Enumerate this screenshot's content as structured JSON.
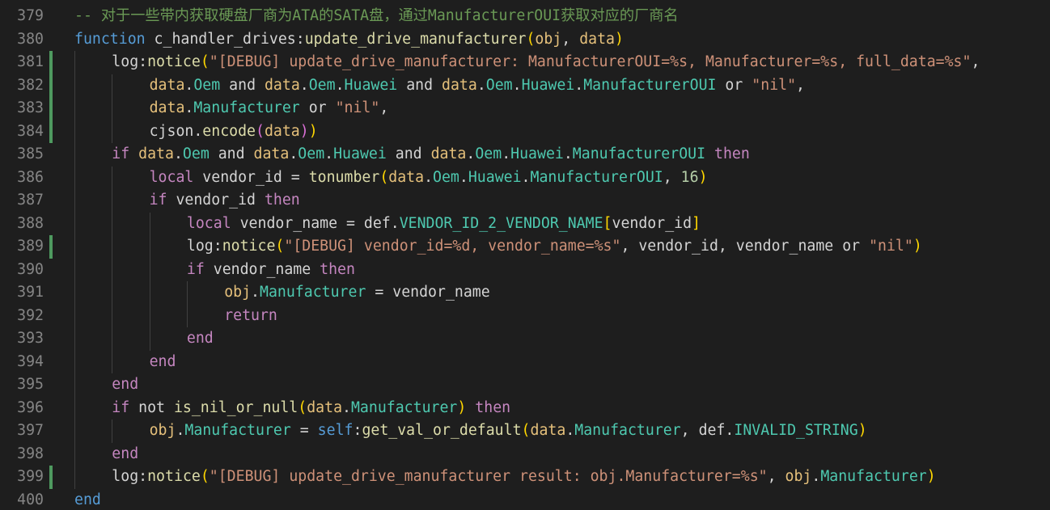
{
  "editor": {
    "lines": [
      {
        "num": "379",
        "indent": 0,
        "mod": false,
        "tokens": [
          [
            "cm",
            "-- 对于一些带内获取硬盘厂商为ATA的SATA盘，通过ManufacturerOUI获取对应的厂商名"
          ]
        ]
      },
      {
        "num": "380",
        "indent": 0,
        "mod": false,
        "tokens": [
          [
            "kw2",
            "function"
          ],
          [
            "var",
            " c_handler_drives:"
          ],
          [
            "fn",
            "update_drive_manufacturer"
          ],
          [
            "br1",
            "("
          ],
          [
            "obj",
            "obj"
          ],
          [
            "var",
            ", "
          ],
          [
            "obj",
            "data"
          ],
          [
            "br1",
            ")"
          ]
        ]
      },
      {
        "num": "381",
        "indent": 1,
        "mod": true,
        "tokens": [
          [
            "var",
            "log:"
          ],
          [
            "fn",
            "notice"
          ],
          [
            "br1",
            "("
          ],
          [
            "str",
            "\"[DEBUG] update_drive_manufacturer: ManufacturerOUI=%s, Manufacturer=%s, full_data=%s\""
          ],
          [
            "var",
            ","
          ]
        ]
      },
      {
        "num": "382",
        "indent": 2,
        "mod": true,
        "tokens": [
          [
            "obj",
            "data"
          ],
          [
            "var",
            "."
          ],
          [
            "fld",
            "Oem"
          ],
          [
            "var",
            " and "
          ],
          [
            "obj",
            "data"
          ],
          [
            "var",
            "."
          ],
          [
            "fld",
            "Oem"
          ],
          [
            "var",
            "."
          ],
          [
            "fld",
            "Huawei"
          ],
          [
            "var",
            " and "
          ],
          [
            "obj",
            "data"
          ],
          [
            "var",
            "."
          ],
          [
            "fld",
            "Oem"
          ],
          [
            "var",
            "."
          ],
          [
            "fld",
            "Huawei"
          ],
          [
            "var",
            "."
          ],
          [
            "fld",
            "ManufacturerOUI"
          ],
          [
            "var",
            " or "
          ],
          [
            "str",
            "\"nil\""
          ],
          [
            "var",
            ","
          ]
        ]
      },
      {
        "num": "383",
        "indent": 2,
        "mod": true,
        "tokens": [
          [
            "obj",
            "data"
          ],
          [
            "var",
            "."
          ],
          [
            "fld",
            "Manufacturer"
          ],
          [
            "var",
            " or "
          ],
          [
            "str",
            "\"nil\""
          ],
          [
            "var",
            ","
          ]
        ]
      },
      {
        "num": "384",
        "indent": 2,
        "mod": true,
        "tokens": [
          [
            "var",
            "cjson."
          ],
          [
            "fn",
            "encode"
          ],
          [
            "br2",
            "("
          ],
          [
            "obj",
            "data"
          ],
          [
            "br2",
            ")"
          ],
          [
            "br1",
            ")"
          ]
        ]
      },
      {
        "num": "385",
        "indent": 1,
        "mod": false,
        "tokens": [
          [
            "kw",
            "if"
          ],
          [
            "var",
            " "
          ],
          [
            "obj",
            "data"
          ],
          [
            "var",
            "."
          ],
          [
            "fld",
            "Oem"
          ],
          [
            "var",
            " and "
          ],
          [
            "obj",
            "data"
          ],
          [
            "var",
            "."
          ],
          [
            "fld",
            "Oem"
          ],
          [
            "var",
            "."
          ],
          [
            "fld",
            "Huawei"
          ],
          [
            "var",
            " and "
          ],
          [
            "obj",
            "data"
          ],
          [
            "var",
            "."
          ],
          [
            "fld",
            "Oem"
          ],
          [
            "var",
            "."
          ],
          [
            "fld",
            "Huawei"
          ],
          [
            "var",
            "."
          ],
          [
            "fld",
            "ManufacturerOUI"
          ],
          [
            "var",
            " "
          ],
          [
            "kw",
            "then"
          ]
        ]
      },
      {
        "num": "386",
        "indent": 2,
        "mod": false,
        "tokens": [
          [
            "kw",
            "local"
          ],
          [
            "var",
            " vendor_id = "
          ],
          [
            "fn",
            "tonumber"
          ],
          [
            "br1",
            "("
          ],
          [
            "obj",
            "data"
          ],
          [
            "var",
            "."
          ],
          [
            "fld",
            "Oem"
          ],
          [
            "var",
            "."
          ],
          [
            "fld",
            "Huawei"
          ],
          [
            "var",
            "."
          ],
          [
            "fld",
            "ManufacturerOUI"
          ],
          [
            "var",
            ", "
          ],
          [
            "num",
            "16"
          ],
          [
            "br1",
            ")"
          ]
        ]
      },
      {
        "num": "387",
        "indent": 2,
        "mod": false,
        "tokens": [
          [
            "kw",
            "if"
          ],
          [
            "var",
            " vendor_id "
          ],
          [
            "kw",
            "then"
          ]
        ]
      },
      {
        "num": "388",
        "indent": 3,
        "mod": false,
        "tokens": [
          [
            "kw",
            "local"
          ],
          [
            "var",
            " vendor_name = def."
          ],
          [
            "fld",
            "VENDOR_ID_2_VENDOR_NAME"
          ],
          [
            "br1",
            "["
          ],
          [
            "var",
            "vendor_id"
          ],
          [
            "br1",
            "]"
          ]
        ]
      },
      {
        "num": "389",
        "indent": 3,
        "mod": true,
        "tokens": [
          [
            "var",
            "log:"
          ],
          [
            "fn",
            "notice"
          ],
          [
            "br1",
            "("
          ],
          [
            "str",
            "\"[DEBUG] vendor_id=%d, vendor_name=%s\""
          ],
          [
            "var",
            ", vendor_id, vendor_name or "
          ],
          [
            "str",
            "\"nil\""
          ],
          [
            "br1",
            ")"
          ]
        ]
      },
      {
        "num": "390",
        "indent": 3,
        "mod": false,
        "tokens": [
          [
            "kw",
            "if"
          ],
          [
            "var",
            " vendor_name "
          ],
          [
            "kw",
            "then"
          ]
        ]
      },
      {
        "num": "391",
        "indent": 4,
        "mod": false,
        "tokens": [
          [
            "obj",
            "obj"
          ],
          [
            "var",
            "."
          ],
          [
            "fld",
            "Manufacturer"
          ],
          [
            "var",
            " = vendor_name"
          ]
        ]
      },
      {
        "num": "392",
        "indent": 4,
        "mod": false,
        "tokens": [
          [
            "kw",
            "return"
          ]
        ]
      },
      {
        "num": "393",
        "indent": 3,
        "mod": false,
        "tokens": [
          [
            "kw",
            "end"
          ]
        ]
      },
      {
        "num": "394",
        "indent": 2,
        "mod": false,
        "tokens": [
          [
            "kw",
            "end"
          ]
        ]
      },
      {
        "num": "395",
        "indent": 1,
        "mod": false,
        "tokens": [
          [
            "kw",
            "end"
          ]
        ]
      },
      {
        "num": "396",
        "indent": 1,
        "mod": false,
        "tokens": [
          [
            "kw",
            "if"
          ],
          [
            "var",
            " not "
          ],
          [
            "fn",
            "is_nil_or_null"
          ],
          [
            "br1",
            "("
          ],
          [
            "obj",
            "data"
          ],
          [
            "var",
            "."
          ],
          [
            "fld",
            "Manufacturer"
          ],
          [
            "br1",
            ")"
          ],
          [
            "var",
            " "
          ],
          [
            "kw",
            "then"
          ]
        ]
      },
      {
        "num": "397",
        "indent": 2,
        "mod": false,
        "tokens": [
          [
            "obj",
            "obj"
          ],
          [
            "var",
            "."
          ],
          [
            "fld",
            "Manufacturer"
          ],
          [
            "var",
            " = "
          ],
          [
            "kw2",
            "self"
          ],
          [
            "var",
            ":"
          ],
          [
            "fn",
            "get_val_or_default"
          ],
          [
            "br1",
            "("
          ],
          [
            "obj",
            "data"
          ],
          [
            "var",
            "."
          ],
          [
            "fld",
            "Manufacturer"
          ],
          [
            "var",
            ", def."
          ],
          [
            "fld",
            "INVALID_STRING"
          ],
          [
            "br1",
            ")"
          ]
        ]
      },
      {
        "num": "398",
        "indent": 1,
        "mod": false,
        "tokens": [
          [
            "kw",
            "end"
          ]
        ]
      },
      {
        "num": "399",
        "indent": 1,
        "mod": true,
        "tokens": [
          [
            "var",
            "log:"
          ],
          [
            "fn",
            "notice"
          ],
          [
            "br1",
            "("
          ],
          [
            "str",
            "\"[DEBUG] update_drive_manufacturer result: obj.Manufacturer=%s\""
          ],
          [
            "var",
            ", "
          ],
          [
            "obj",
            "obj"
          ],
          [
            "var",
            "."
          ],
          [
            "fld",
            "Manufacturer"
          ],
          [
            "br1",
            ")"
          ]
        ]
      },
      {
        "num": "400",
        "indent": 0,
        "mod": false,
        "tokens": [
          [
            "kw2",
            "end"
          ]
        ]
      }
    ]
  },
  "colors": {
    "background": "#1e1e1e",
    "line_number": "#858585",
    "modified_marker": "#4e9a5f"
  }
}
